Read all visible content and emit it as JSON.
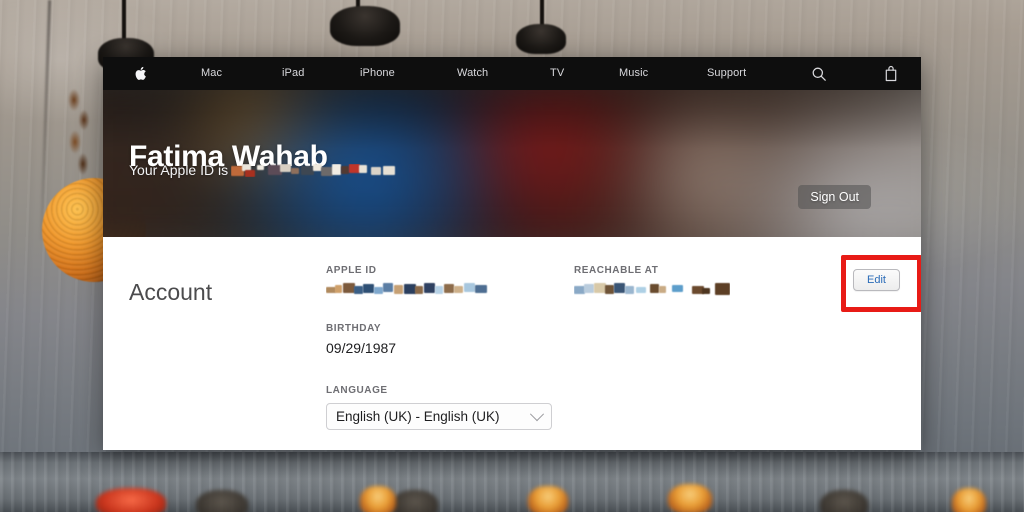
{
  "background": {
    "description": "concrete-wall-with-pendant-lamps-photo"
  },
  "globalnav": {
    "apple_logo": "apple-logo",
    "items": [
      {
        "label": "Mac"
      },
      {
        "label": "iPad"
      },
      {
        "label": "iPhone"
      },
      {
        "label": "Watch"
      },
      {
        "label": "TV"
      },
      {
        "label": "Music"
      },
      {
        "label": "Support"
      }
    ],
    "search_icon": "search-icon",
    "bag_icon": "shopping-bag-icon"
  },
  "hero": {
    "name": "Fatima Wahab",
    "subtitle_prefix": "Your Apple ID is",
    "subtitle_value_redacted": "▬▬▬▬▬",
    "sign_out_label": "Sign Out"
  },
  "account": {
    "section_title": "Account",
    "edit_label": "Edit",
    "highlight_color": "#e81b16",
    "fields": {
      "apple_id": {
        "label": "APPLE ID",
        "value_redacted": "▬▬▬▬"
      },
      "reachable_at": {
        "label": "REACHABLE AT",
        "value_redacted": "▬▬▬▬"
      },
      "birthday": {
        "label": "BIRTHDAY",
        "value": "09/29/1987"
      },
      "language": {
        "label": "LANGUAGE",
        "selected": "English (UK) - English (UK)"
      }
    }
  }
}
